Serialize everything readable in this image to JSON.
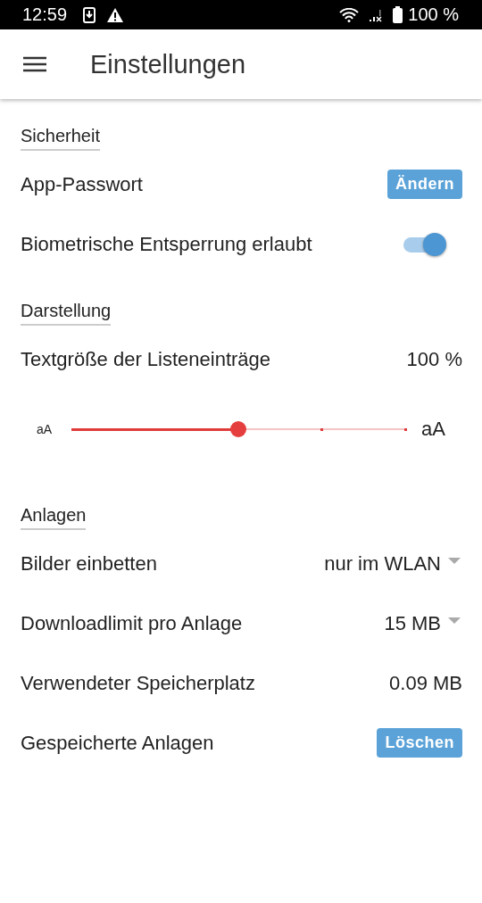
{
  "status_bar": {
    "time": "12:59",
    "battery": "100 %"
  },
  "app_bar": {
    "title": "Einstellungen"
  },
  "sections": [
    {
      "title": "Sicherheit",
      "rows": [
        {
          "kind": "button",
          "label": "App-Passwort",
          "button": "Ändern"
        },
        {
          "kind": "toggle",
          "label": "Biometrische Entsperrung erlaubt",
          "on": true
        }
      ]
    },
    {
      "title": "Darstellung",
      "rows": [
        {
          "kind": "value",
          "label": "Textgröße der Listeneinträge",
          "value": "100 %"
        },
        {
          "kind": "slider",
          "min_label": "aA",
          "max_label": "aA",
          "level": 0.5
        }
      ]
    },
    {
      "title": "Anlagen",
      "rows": [
        {
          "kind": "dropdown",
          "label": "Bilder einbetten",
          "value": "nur im WLAN"
        },
        {
          "kind": "dropdown",
          "label": "Downloadlimit pro Anlage",
          "value": "15 MB"
        },
        {
          "kind": "value",
          "label": "Verwendeter Speicherplatz",
          "value": "0.09 MB"
        },
        {
          "kind": "button",
          "label": "Gespeicherte Anlagen",
          "button": "Löschen"
        }
      ]
    }
  ]
}
